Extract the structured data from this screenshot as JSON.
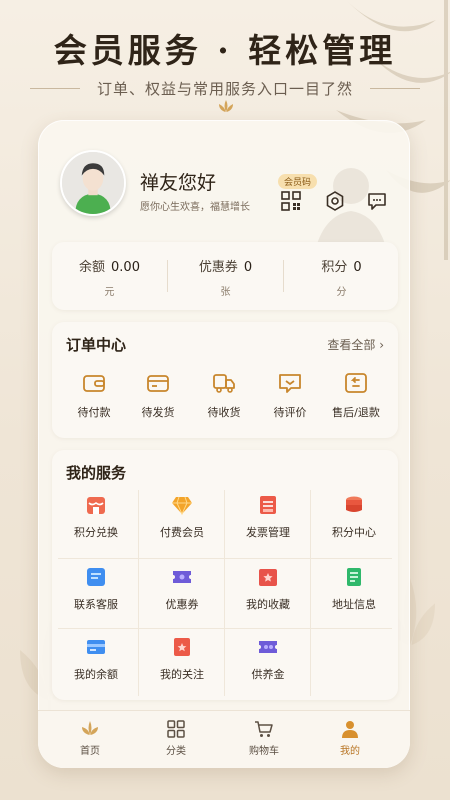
{
  "banner": {
    "title": "会员服务 · 轻松管理",
    "subtitle": "订单、权益与常用服务入口一目了然"
  },
  "profile": {
    "greeting": "禅友您好",
    "wish": "愿你心生欢喜，福慧增长",
    "vip_badge": "会员码",
    "tools": [
      "qrcode-icon",
      "settings-icon",
      "message-icon"
    ]
  },
  "assets": [
    {
      "label": "余额",
      "value": "0.00",
      "unit": "元"
    },
    {
      "label": "优惠券",
      "value": "0",
      "unit": "张"
    },
    {
      "label": "积分",
      "value": "0",
      "unit": "分"
    }
  ],
  "orders": {
    "title": "订单中心",
    "view_all": "查看全部 ›",
    "items": [
      {
        "label": "待付款",
        "icon": "wallet-icon"
      },
      {
        "label": "待发货",
        "icon": "package-icon"
      },
      {
        "label": "待收货",
        "icon": "truck-icon"
      },
      {
        "label": "待评价",
        "icon": "review-icon"
      },
      {
        "label": "售后/退款",
        "icon": "refund-icon"
      }
    ]
  },
  "services": {
    "title": "我的服务",
    "items": [
      {
        "label": "积分兑换",
        "icon": "store-icon"
      },
      {
        "label": "付费会员",
        "icon": "diamond-icon"
      },
      {
        "label": "发票管理",
        "icon": "invoice-icon"
      },
      {
        "label": "积分中心",
        "icon": "coins-icon"
      },
      {
        "label": "联系客服",
        "icon": "chat-icon"
      },
      {
        "label": "优惠券",
        "icon": "coupon-icon"
      },
      {
        "label": "我的收藏",
        "icon": "favorites-icon"
      },
      {
        "label": "地址信息",
        "icon": "address-icon"
      },
      {
        "label": "我的余额",
        "icon": "card-icon"
      },
      {
        "label": "我的关注",
        "icon": "follow-icon"
      },
      {
        "label": "供养金",
        "icon": "ticket-icon"
      }
    ]
  },
  "tabbar": [
    {
      "label": "首页",
      "icon": "lotus-icon"
    },
    {
      "label": "分类",
      "icon": "grid-icon"
    },
    {
      "label": "购物车",
      "icon": "cart-icon"
    },
    {
      "label": "我的",
      "icon": "user-icon",
      "active": true
    }
  ],
  "colors": {
    "accent": "#b87524",
    "warm_bg": "#f6efe4",
    "icon_orange": "#d8902e",
    "icon_red": "#e8534a",
    "icon_blue": "#3f8ef0",
    "icon_purple": "#6e5bd8",
    "icon_green": "#2fb86b"
  }
}
